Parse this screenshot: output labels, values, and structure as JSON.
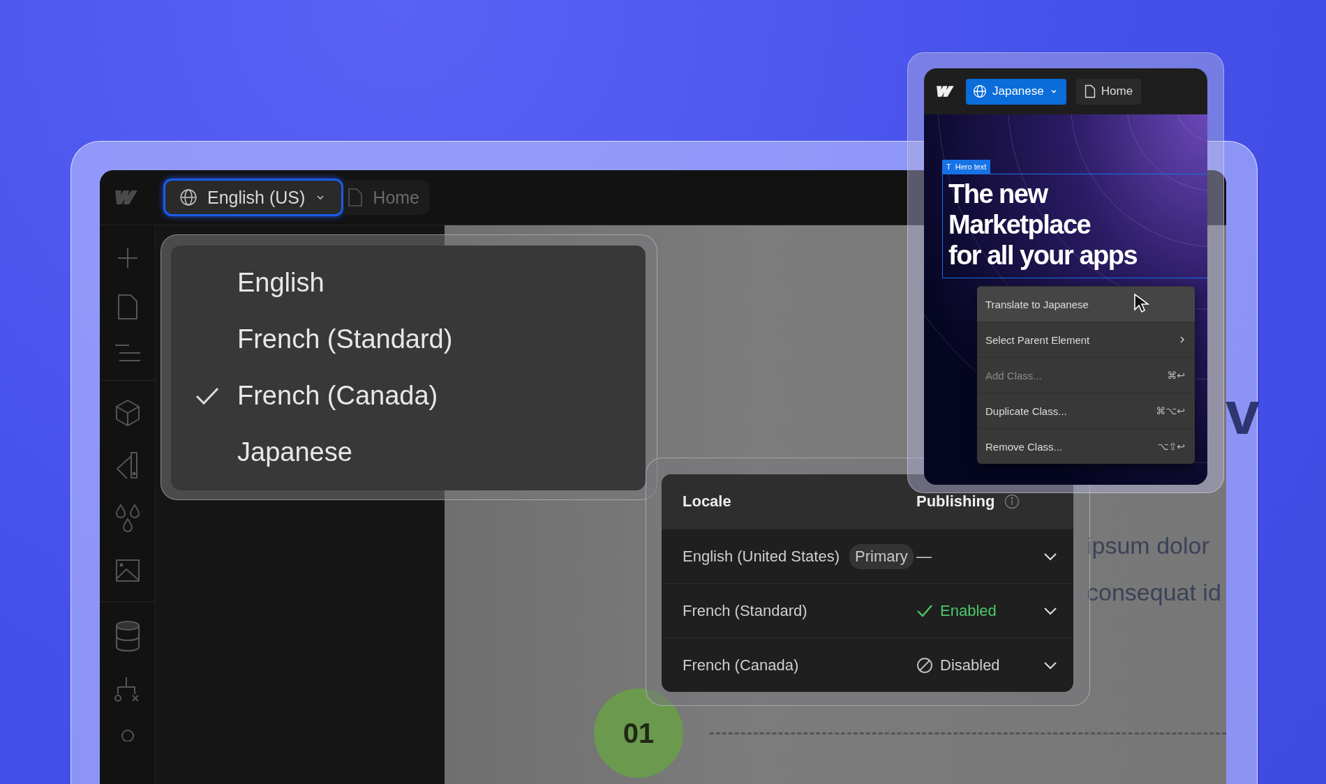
{
  "editor": {
    "locale_button": {
      "label": "English (US)",
      "focused": true
    },
    "page_button": {
      "label": "Home"
    }
  },
  "locale_menu": {
    "items": [
      {
        "label": "English",
        "checked": false
      },
      {
        "label": "French (Standard)",
        "checked": false
      },
      {
        "label": "French (Canada)",
        "checked": true
      },
      {
        "label": "Japanese",
        "checked": false
      }
    ]
  },
  "locales_panel": {
    "columns": [
      "Locale",
      "Publishing"
    ],
    "rows": [
      {
        "name": "English (United States)",
        "badge": "Primary",
        "status": "—",
        "kind": "none"
      },
      {
        "name": "French (Standard)",
        "status": "Enabled",
        "kind": "enabled"
      },
      {
        "name": "French (Canada)",
        "status": "Disabled",
        "kind": "disabled"
      }
    ]
  },
  "canvas": {
    "heading_fragment": "v",
    "lines": [
      "ipsum dolor",
      "consequat id"
    ],
    "step": "01"
  },
  "preview": {
    "locale_button": {
      "label": "Japanese"
    },
    "page_button": {
      "label": "Home"
    },
    "element_tag": {
      "icon": "T",
      "label": "Hero text"
    },
    "heading": [
      "The new",
      "Marketplace",
      "for all your apps"
    ],
    "context_menu": [
      {
        "label": "Translate to Japanese",
        "selected": true,
        "disabled": false,
        "submenu": false
      },
      {
        "label": "Select Parent Element",
        "selected": false,
        "disabled": false,
        "submenu": true
      },
      {
        "label": "Add Class...",
        "shortcut": "⌘↩",
        "selected": false,
        "disabled": true,
        "submenu": false
      },
      {
        "label": "Duplicate Class...",
        "shortcut": "⌘⌥↩",
        "selected": false,
        "disabled": false,
        "submenu": false
      },
      {
        "label": "Remove Class...",
        "shortcut": "⌥⇧↩",
        "selected": false,
        "disabled": false,
        "submenu": false
      }
    ]
  }
}
